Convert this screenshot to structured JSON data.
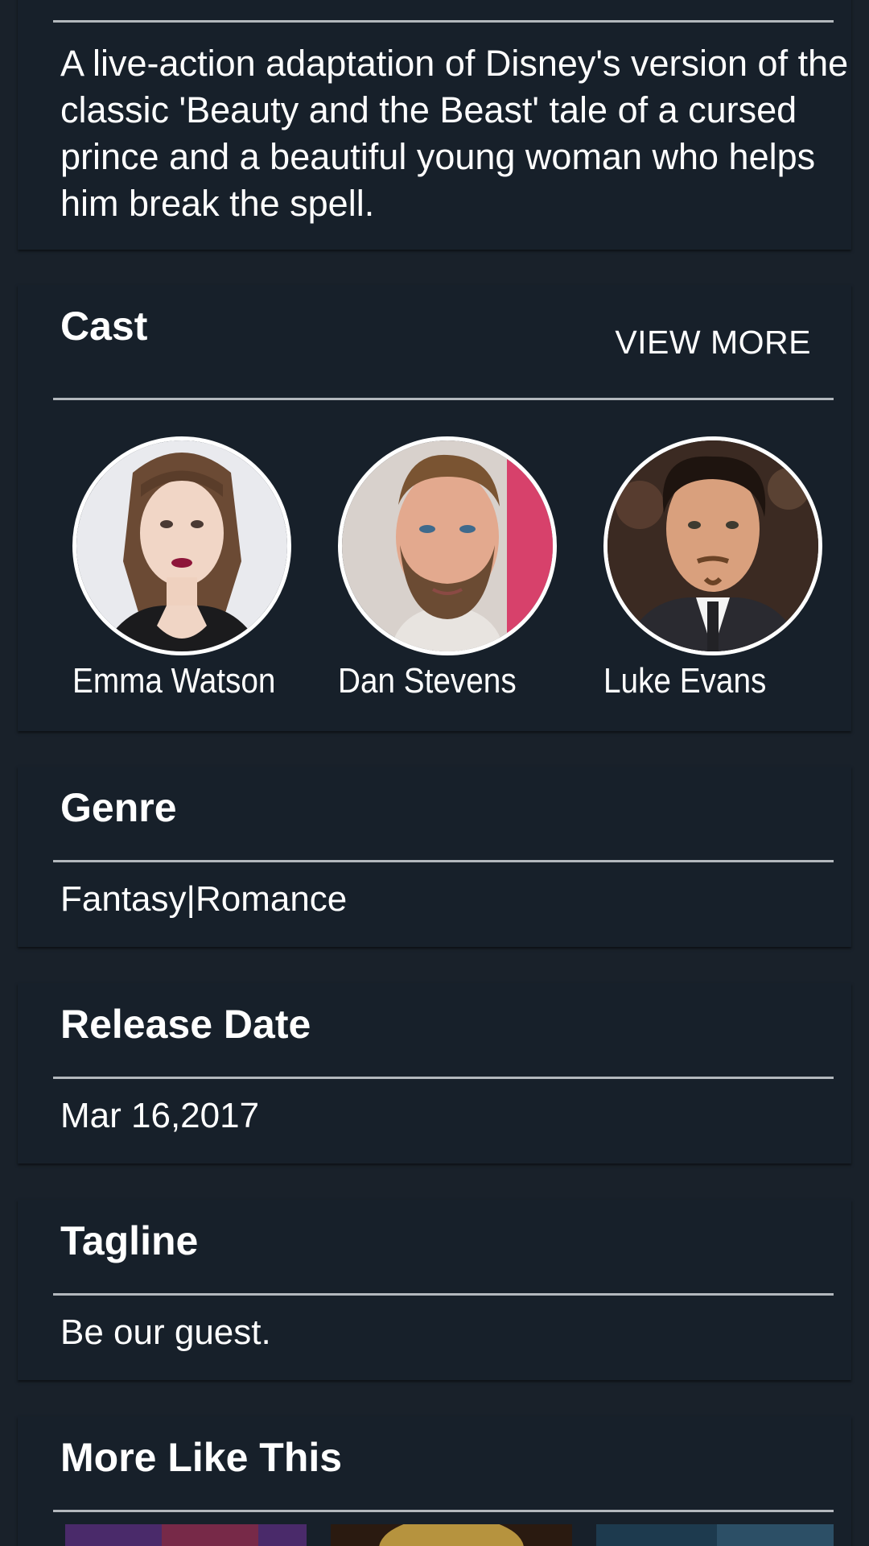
{
  "overview": {
    "text": "A live-action adaptation of Disney's version of the classic 'Beauty and the Beast' tale of a cursed prince and a beautiful young woman who helps him break the spell."
  },
  "cast": {
    "title": "Cast",
    "view_more_label": "VIEW MORE",
    "members": [
      {
        "name": "Emma Watson"
      },
      {
        "name": "Dan Stevens"
      },
      {
        "name": "Luke Evans"
      }
    ]
  },
  "genre": {
    "title": "Genre",
    "value": "Fantasy|Romance"
  },
  "release_date": {
    "title": "Release Date",
    "value": "Mar 16,2017"
  },
  "tagline": {
    "title": "Tagline",
    "value": "Be our guest."
  },
  "more_like_this": {
    "title": "More Like This"
  },
  "colors": {
    "background": "#19212a",
    "card": "#17202a",
    "divider": "#b3b8bd",
    "text": "#ffffff"
  }
}
